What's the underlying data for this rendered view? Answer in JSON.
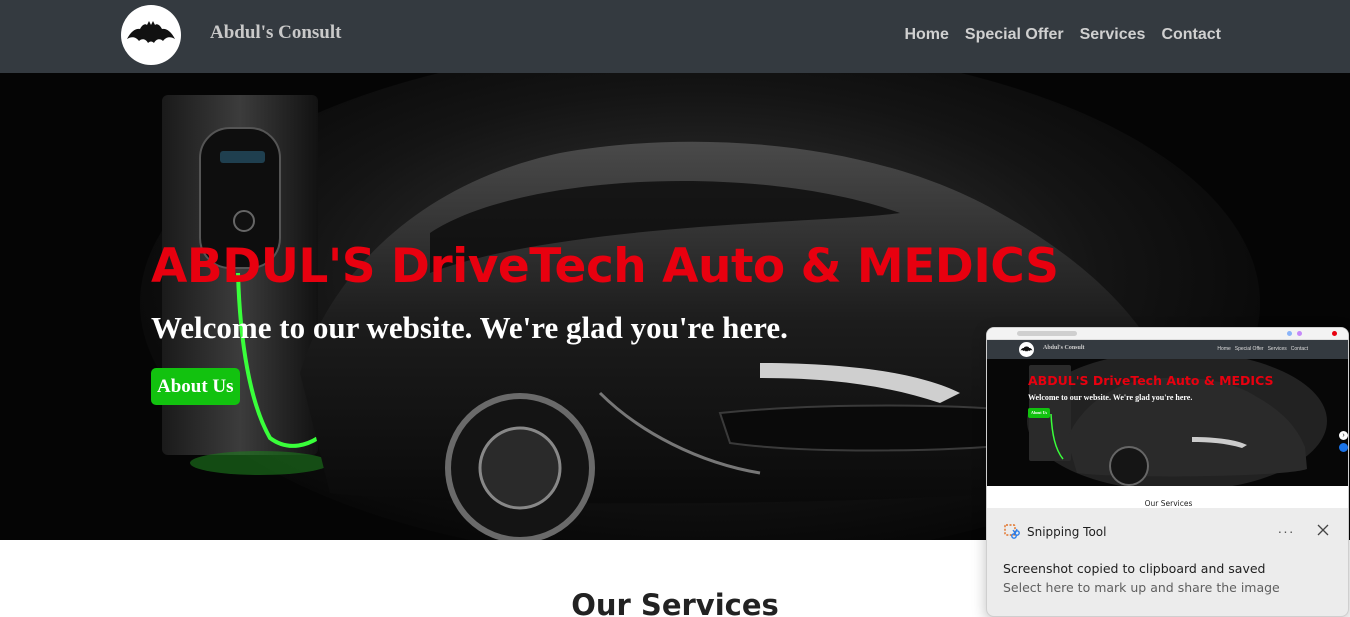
{
  "navbar": {
    "brand": "Abdul's Consult",
    "links": [
      "Home",
      "Special Offer",
      "Services",
      "Contact"
    ],
    "background": "#343a40"
  },
  "hero": {
    "title": "ABDUL'S DriveTech Auto & MEDICS",
    "subtitle": "Welcome to our website. We're glad you're here.",
    "button": "About Us",
    "title_color": "#e8000f",
    "button_color": "#12c20f"
  },
  "services": {
    "heading": "Our Services"
  },
  "notification": {
    "app_name": "Snipping Tool",
    "message": "Screenshot copied to clipboard and saved",
    "hint": "Select here to mark up and share the image",
    "more_icon": "more-icon",
    "close_icon": "close-icon",
    "preview": {
      "brand": "Abdul's Consult",
      "links": [
        "Home",
        "Special Offer",
        "Services",
        "Contact"
      ],
      "title": "ABDUL'S DriveTech Auto & MEDICS",
      "subtitle": "Welcome to our website. We're glad you're here.",
      "button": "About Us",
      "services_heading": "Our Services"
    }
  }
}
